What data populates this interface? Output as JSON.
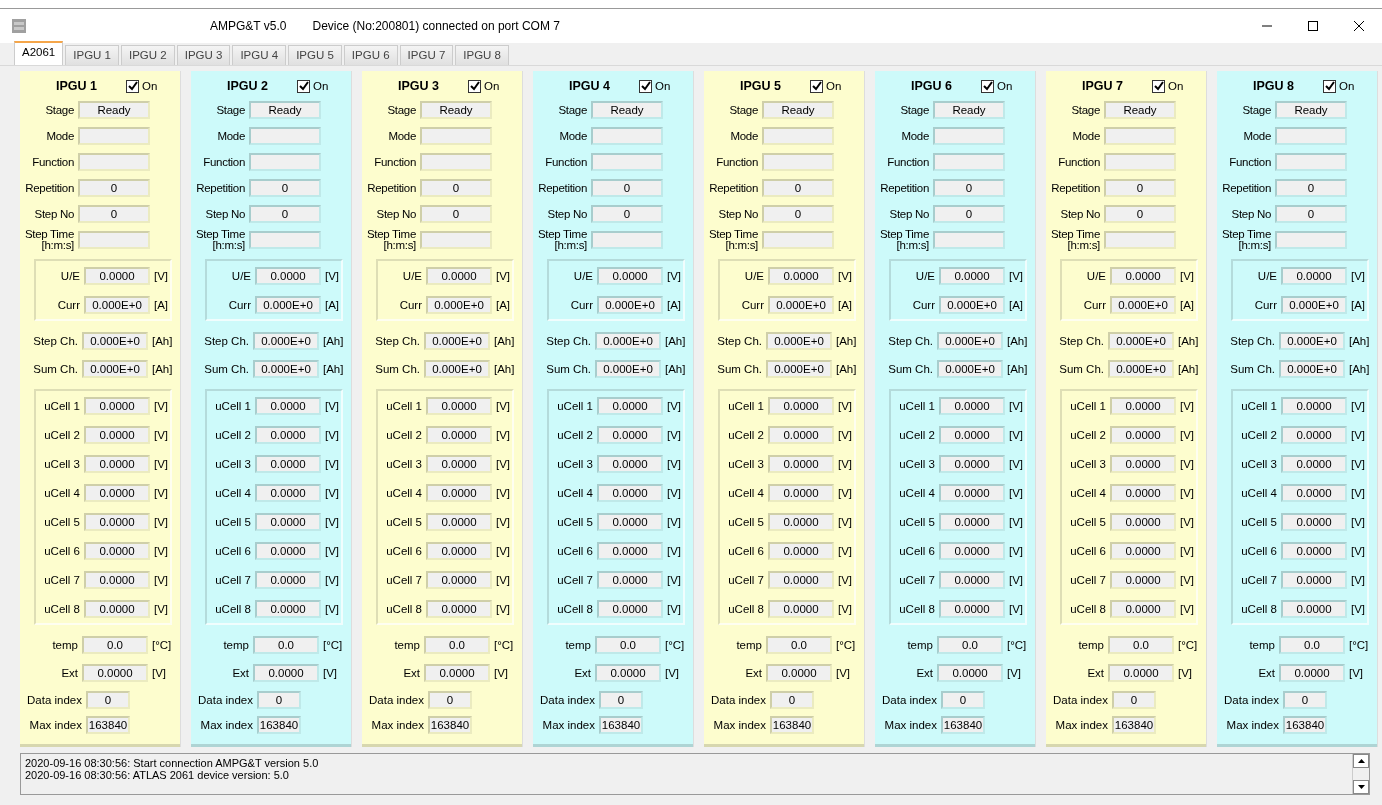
{
  "window": {
    "title": "AMPG&T v5.0",
    "status": "Device (No:200801) connected on port COM 7"
  },
  "tabs": [
    {
      "label": "A2061",
      "selected": true
    },
    {
      "label": "IPGU 1",
      "selected": false
    },
    {
      "label": "IPGU 2",
      "selected": false
    },
    {
      "label": "IPGU 3",
      "selected": false
    },
    {
      "label": "IPGU 4",
      "selected": false
    },
    {
      "label": "IPGU 5",
      "selected": false
    },
    {
      "label": "IPGU 6",
      "selected": false
    },
    {
      "label": "IPGU 7",
      "selected": false
    },
    {
      "label": "IPGU 8",
      "selected": false
    }
  ],
  "panels": [
    {
      "title": "IPGU 1",
      "on_label": "On",
      "on": true,
      "color": "#fdfdce",
      "sections": [
        {
          "kind": "info",
          "rows": [
            {
              "label": "Stage",
              "value": "Ready"
            },
            {
              "label": "Mode"
            },
            {
              "label": "Function"
            },
            {
              "label": "Repetition",
              "value": "0"
            },
            {
              "label": "Step No",
              "value": "0"
            },
            {
              "label": "Step Time [h:m:s]"
            }
          ]
        },
        {
          "kind": "group",
          "rows": [
            {
              "label": "U/E",
              "value": "0.0000",
              "unit": "[V]"
            },
            {
              "label": "Curr",
              "value": "0.000E+0",
              "unit": "[A]"
            }
          ]
        },
        {
          "kind": "plain",
          "rows": [
            {
              "label": "Step Ch.",
              "value": "0.000E+0",
              "unit": "[Ah]"
            },
            {
              "label": "Sum Ch.",
              "value": "0.000E+0",
              "unit": "[Ah]"
            }
          ]
        },
        {
          "kind": "group",
          "rows": [
            {
              "label": "uCell 1",
              "value": "0.0000",
              "unit": "[V]"
            },
            {
              "label": "uCell 2",
              "value": "0.0000",
              "unit": "[V]"
            },
            {
              "label": "uCell 3",
              "value": "0.0000",
              "unit": "[V]"
            },
            {
              "label": "uCell 4",
              "value": "0.0000",
              "unit": "[V]"
            },
            {
              "label": "uCell 5",
              "value": "0.0000",
              "unit": "[V]"
            },
            {
              "label": "uCell 6",
              "value": "0.0000",
              "unit": "[V]"
            },
            {
              "label": "uCell 7",
              "value": "0.0000",
              "unit": "[V]"
            },
            {
              "label": "uCell 8",
              "value": "0.0000",
              "unit": "[V]"
            }
          ]
        },
        {
          "kind": "plain",
          "rows": [
            {
              "label": "temp",
              "value": "0.0",
              "unit": "[°C]"
            },
            {
              "label": "Ext",
              "value": "0.0000",
              "unit": "[V]"
            }
          ]
        },
        {
          "kind": "index",
          "rows": [
            {
              "label": "Data index",
              "value": "0"
            },
            {
              "label": "Max index",
              "value": "163840"
            }
          ]
        }
      ]
    },
    {
      "title": "IPGU 2",
      "on_label": "On",
      "on": true,
      "color": "#cdfafa",
      "sections": [
        {
          "kind": "info",
          "rows": [
            {
              "label": "Stage",
              "value": "Ready"
            },
            {
              "label": "Mode"
            },
            {
              "label": "Function"
            },
            {
              "label": "Repetition",
              "value": "0"
            },
            {
              "label": "Step No",
              "value": "0"
            },
            {
              "label": "Step Time [h:m:s]"
            }
          ]
        },
        {
          "kind": "group",
          "rows": [
            {
              "label": "U/E",
              "value": "0.0000",
              "unit": "[V]"
            },
            {
              "label": "Curr",
              "value": "0.000E+0",
              "unit": "[A]"
            }
          ]
        },
        {
          "kind": "plain",
          "rows": [
            {
              "label": "Step Ch.",
              "value": "0.000E+0",
              "unit": "[Ah]"
            },
            {
              "label": "Sum Ch.",
              "value": "0.000E+0",
              "unit": "[Ah]"
            }
          ]
        },
        {
          "kind": "group",
          "rows": [
            {
              "label": "uCell 1",
              "value": "0.0000",
              "unit": "[V]"
            },
            {
              "label": "uCell 2",
              "value": "0.0000",
              "unit": "[V]"
            },
            {
              "label": "uCell 3",
              "value": "0.0000",
              "unit": "[V]"
            },
            {
              "label": "uCell 4",
              "value": "0.0000",
              "unit": "[V]"
            },
            {
              "label": "uCell 5",
              "value": "0.0000",
              "unit": "[V]"
            },
            {
              "label": "uCell 6",
              "value": "0.0000",
              "unit": "[V]"
            },
            {
              "label": "uCell 7",
              "value": "0.0000",
              "unit": "[V]"
            },
            {
              "label": "uCell 8",
              "value": "0.0000",
              "unit": "[V]"
            }
          ]
        },
        {
          "kind": "plain",
          "rows": [
            {
              "label": "temp",
              "value": "0.0",
              "unit": "[°C]"
            },
            {
              "label": "Ext",
              "value": "0.0000",
              "unit": "[V]"
            }
          ]
        },
        {
          "kind": "index",
          "rows": [
            {
              "label": "Data index",
              "value": "0"
            },
            {
              "label": "Max index",
              "value": "163840"
            }
          ]
        }
      ]
    },
    {
      "title": "IPGU 3",
      "on_label": "On",
      "on": true,
      "color": "#fdfdce",
      "sections": [
        {
          "kind": "info",
          "rows": [
            {
              "label": "Stage",
              "value": "Ready"
            },
            {
              "label": "Mode"
            },
            {
              "label": "Function"
            },
            {
              "label": "Repetition",
              "value": "0"
            },
            {
              "label": "Step No",
              "value": "0"
            },
            {
              "label": "Step Time [h:m:s]"
            }
          ]
        },
        {
          "kind": "group",
          "rows": [
            {
              "label": "U/E",
              "value": "0.0000",
              "unit": "[V]"
            },
            {
              "label": "Curr",
              "value": "0.000E+0",
              "unit": "[A]"
            }
          ]
        },
        {
          "kind": "plain",
          "rows": [
            {
              "label": "Step Ch.",
              "value": "0.000E+0",
              "unit": "[Ah]"
            },
            {
              "label": "Sum Ch.",
              "value": "0.000E+0",
              "unit": "[Ah]"
            }
          ]
        },
        {
          "kind": "group",
          "rows": [
            {
              "label": "uCell 1",
              "value": "0.0000",
              "unit": "[V]"
            },
            {
              "label": "uCell 2",
              "value": "0.0000",
              "unit": "[V]"
            },
            {
              "label": "uCell 3",
              "value": "0.0000",
              "unit": "[V]"
            },
            {
              "label": "uCell 4",
              "value": "0.0000",
              "unit": "[V]"
            },
            {
              "label": "uCell 5",
              "value": "0.0000",
              "unit": "[V]"
            },
            {
              "label": "uCell 6",
              "value": "0.0000",
              "unit": "[V]"
            },
            {
              "label": "uCell 7",
              "value": "0.0000",
              "unit": "[V]"
            },
            {
              "label": "uCell 8",
              "value": "0.0000",
              "unit": "[V]"
            }
          ]
        },
        {
          "kind": "plain",
          "rows": [
            {
              "label": "temp",
              "value": "0.0",
              "unit": "[°C]"
            },
            {
              "label": "Ext",
              "value": "0.0000",
              "unit": "[V]"
            }
          ]
        },
        {
          "kind": "index",
          "rows": [
            {
              "label": "Data index",
              "value": "0"
            },
            {
              "label": "Max index",
              "value": "163840"
            }
          ]
        }
      ]
    },
    {
      "title": "IPGU 4",
      "on_label": "On",
      "on": true,
      "color": "#cdfafa",
      "sections": [
        {
          "kind": "info",
          "rows": [
            {
              "label": "Stage",
              "value": "Ready"
            },
            {
              "label": "Mode"
            },
            {
              "label": "Function"
            },
            {
              "label": "Repetition",
              "value": "0"
            },
            {
              "label": "Step No",
              "value": "0"
            },
            {
              "label": "Step Time [h:m:s]"
            }
          ]
        },
        {
          "kind": "group",
          "rows": [
            {
              "label": "U/E",
              "value": "0.0000",
              "unit": "[V]"
            },
            {
              "label": "Curr",
              "value": "0.000E+0",
              "unit": "[A]"
            }
          ]
        },
        {
          "kind": "plain",
          "rows": [
            {
              "label": "Step Ch.",
              "value": "0.000E+0",
              "unit": "[Ah]"
            },
            {
              "label": "Sum Ch.",
              "value": "0.000E+0",
              "unit": "[Ah]"
            }
          ]
        },
        {
          "kind": "group",
          "rows": [
            {
              "label": "uCell 1",
              "value": "0.0000",
              "unit": "[V]"
            },
            {
              "label": "uCell 2",
              "value": "0.0000",
              "unit": "[V]"
            },
            {
              "label": "uCell 3",
              "value": "0.0000",
              "unit": "[V]"
            },
            {
              "label": "uCell 4",
              "value": "0.0000",
              "unit": "[V]"
            },
            {
              "label": "uCell 5",
              "value": "0.0000",
              "unit": "[V]"
            },
            {
              "label": "uCell 6",
              "value": "0.0000",
              "unit": "[V]"
            },
            {
              "label": "uCell 7",
              "value": "0.0000",
              "unit": "[V]"
            },
            {
              "label": "uCell 8",
              "value": "0.0000",
              "unit": "[V]"
            }
          ]
        },
        {
          "kind": "plain",
          "rows": [
            {
              "label": "temp",
              "value": "0.0",
              "unit": "[°C]"
            },
            {
              "label": "Ext",
              "value": "0.0000",
              "unit": "[V]"
            }
          ]
        },
        {
          "kind": "index",
          "rows": [
            {
              "label": "Data index",
              "value": "0"
            },
            {
              "label": "Max index",
              "value": "163840"
            }
          ]
        }
      ]
    },
    {
      "title": "IPGU 5",
      "on_label": "On",
      "on": true,
      "color": "#fdfdce",
      "sections": [
        {
          "kind": "info",
          "rows": [
            {
              "label": "Stage",
              "value": "Ready"
            },
            {
              "label": "Mode"
            },
            {
              "label": "Function"
            },
            {
              "label": "Repetition",
              "value": "0"
            },
            {
              "label": "Step No",
              "value": "0"
            },
            {
              "label": "Step Time [h:m:s]"
            }
          ]
        },
        {
          "kind": "group",
          "rows": [
            {
              "label": "U/E",
              "value": "0.0000",
              "unit": "[V]"
            },
            {
              "label": "Curr",
              "value": "0.000E+0",
              "unit": "[A]"
            }
          ]
        },
        {
          "kind": "plain",
          "rows": [
            {
              "label": "Step Ch.",
              "value": "0.000E+0",
              "unit": "[Ah]"
            },
            {
              "label": "Sum Ch.",
              "value": "0.000E+0",
              "unit": "[Ah]"
            }
          ]
        },
        {
          "kind": "group",
          "rows": [
            {
              "label": "uCell 1",
              "value": "0.0000",
              "unit": "[V]"
            },
            {
              "label": "uCell 2",
              "value": "0.0000",
              "unit": "[V]"
            },
            {
              "label": "uCell 3",
              "value": "0.0000",
              "unit": "[V]"
            },
            {
              "label": "uCell 4",
              "value": "0.0000",
              "unit": "[V]"
            },
            {
              "label": "uCell 5",
              "value": "0.0000",
              "unit": "[V]"
            },
            {
              "label": "uCell 6",
              "value": "0.0000",
              "unit": "[V]"
            },
            {
              "label": "uCell 7",
              "value": "0.0000",
              "unit": "[V]"
            },
            {
              "label": "uCell 8",
              "value": "0.0000",
              "unit": "[V]"
            }
          ]
        },
        {
          "kind": "plain",
          "rows": [
            {
              "label": "temp",
              "value": "0.0",
              "unit": "[°C]"
            },
            {
              "label": "Ext",
              "value": "0.0000",
              "unit": "[V]"
            }
          ]
        },
        {
          "kind": "index",
          "rows": [
            {
              "label": "Data index",
              "value": "0"
            },
            {
              "label": "Max index",
              "value": "163840"
            }
          ]
        }
      ]
    },
    {
      "title": "IPGU 6",
      "on_label": "On",
      "on": true,
      "color": "#cdfafa",
      "sections": [
        {
          "kind": "info",
          "rows": [
            {
              "label": "Stage",
              "value": "Ready"
            },
            {
              "label": "Mode"
            },
            {
              "label": "Function"
            },
            {
              "label": "Repetition",
              "value": "0"
            },
            {
              "label": "Step No",
              "value": "0"
            },
            {
              "label": "Step Time [h:m:s]"
            }
          ]
        },
        {
          "kind": "group",
          "rows": [
            {
              "label": "U/E",
              "value": "0.0000",
              "unit": "[V]"
            },
            {
              "label": "Curr",
              "value": "0.000E+0",
              "unit": "[A]"
            }
          ]
        },
        {
          "kind": "plain",
          "rows": [
            {
              "label": "Step Ch.",
              "value": "0.000E+0",
              "unit": "[Ah]"
            },
            {
              "label": "Sum Ch.",
              "value": "0.000E+0",
              "unit": "[Ah]"
            }
          ]
        },
        {
          "kind": "group",
          "rows": [
            {
              "label": "uCell 1",
              "value": "0.0000",
              "unit": "[V]"
            },
            {
              "label": "uCell 2",
              "value": "0.0000",
              "unit": "[V]"
            },
            {
              "label": "uCell 3",
              "value": "0.0000",
              "unit": "[V]"
            },
            {
              "label": "uCell 4",
              "value": "0.0000",
              "unit": "[V]"
            },
            {
              "label": "uCell 5",
              "value": "0.0000",
              "unit": "[V]"
            },
            {
              "label": "uCell 6",
              "value": "0.0000",
              "unit": "[V]"
            },
            {
              "label": "uCell 7",
              "value": "0.0000",
              "unit": "[V]"
            },
            {
              "label": "uCell 8",
              "value": "0.0000",
              "unit": "[V]"
            }
          ]
        },
        {
          "kind": "plain",
          "rows": [
            {
              "label": "temp",
              "value": "0.0",
              "unit": "[°C]"
            },
            {
              "label": "Ext",
              "value": "0.0000",
              "unit": "[V]"
            }
          ]
        },
        {
          "kind": "index",
          "rows": [
            {
              "label": "Data index",
              "value": "0"
            },
            {
              "label": "Max index",
              "value": "163840"
            }
          ]
        }
      ]
    },
    {
      "title": "IPGU 7",
      "on_label": "On",
      "on": true,
      "color": "#fdfdce",
      "sections": [
        {
          "kind": "info",
          "rows": [
            {
              "label": "Stage",
              "value": "Ready"
            },
            {
              "label": "Mode"
            },
            {
              "label": "Function"
            },
            {
              "label": "Repetition",
              "value": "0"
            },
            {
              "label": "Step No",
              "value": "0"
            },
            {
              "label": "Step Time [h:m:s]"
            }
          ]
        },
        {
          "kind": "group",
          "rows": [
            {
              "label": "U/E",
              "value": "0.0000",
              "unit": "[V]"
            },
            {
              "label": "Curr",
              "value": "0.000E+0",
              "unit": "[A]"
            }
          ]
        },
        {
          "kind": "plain",
          "rows": [
            {
              "label": "Step Ch.",
              "value": "0.000E+0",
              "unit": "[Ah]"
            },
            {
              "label": "Sum Ch.",
              "value": "0.000E+0",
              "unit": "[Ah]"
            }
          ]
        },
        {
          "kind": "group",
          "rows": [
            {
              "label": "uCell 1",
              "value": "0.0000",
              "unit": "[V]"
            },
            {
              "label": "uCell 2",
              "value": "0.0000",
              "unit": "[V]"
            },
            {
              "label": "uCell 3",
              "value": "0.0000",
              "unit": "[V]"
            },
            {
              "label": "uCell 4",
              "value": "0.0000",
              "unit": "[V]"
            },
            {
              "label": "uCell 5",
              "value": "0.0000",
              "unit": "[V]"
            },
            {
              "label": "uCell 6",
              "value": "0.0000",
              "unit": "[V]"
            },
            {
              "label": "uCell 7",
              "value": "0.0000",
              "unit": "[V]"
            },
            {
              "label": "uCell 8",
              "value": "0.0000",
              "unit": "[V]"
            }
          ]
        },
        {
          "kind": "plain",
          "rows": [
            {
              "label": "temp",
              "value": "0.0",
              "unit": "[°C]"
            },
            {
              "label": "Ext",
              "value": "0.0000",
              "unit": "[V]"
            }
          ]
        },
        {
          "kind": "index",
          "rows": [
            {
              "label": "Data index",
              "value": "0"
            },
            {
              "label": "Max index",
              "value": "163840"
            }
          ]
        }
      ]
    },
    {
      "title": "IPGU 8",
      "on_label": "On",
      "on": true,
      "color": "#cdfafa",
      "sections": [
        {
          "kind": "info",
          "rows": [
            {
              "label": "Stage",
              "value": "Ready"
            },
            {
              "label": "Mode"
            },
            {
              "label": "Function"
            },
            {
              "label": "Repetition",
              "value": "0"
            },
            {
              "label": "Step No",
              "value": "0"
            },
            {
              "label": "Step Time [h:m:s]"
            }
          ]
        },
        {
          "kind": "group",
          "rows": [
            {
              "label": "U/E",
              "value": "0.0000",
              "unit": "[V]"
            },
            {
              "label": "Curr",
              "value": "0.000E+0",
              "unit": "[A]"
            }
          ]
        },
        {
          "kind": "plain",
          "rows": [
            {
              "label": "Step Ch.",
              "value": "0.000E+0",
              "unit": "[Ah]"
            },
            {
              "label": "Sum Ch.",
              "value": "0.000E+0",
              "unit": "[Ah]"
            }
          ]
        },
        {
          "kind": "group",
          "rows": [
            {
              "label": "uCell 1",
              "value": "0.0000",
              "unit": "[V]"
            },
            {
              "label": "uCell 2",
              "value": "0.0000",
              "unit": "[V]"
            },
            {
              "label": "uCell 3",
              "value": "0.0000",
              "unit": "[V]"
            },
            {
              "label": "uCell 4",
              "value": "0.0000",
              "unit": "[V]"
            },
            {
              "label": "uCell 5",
              "value": "0.0000",
              "unit": "[V]"
            },
            {
              "label": "uCell 6",
              "value": "0.0000",
              "unit": "[V]"
            },
            {
              "label": "uCell 7",
              "value": "0.0000",
              "unit": "[V]"
            },
            {
              "label": "uCell 8",
              "value": "0.0000",
              "unit": "[V]"
            }
          ]
        },
        {
          "kind": "plain",
          "rows": [
            {
              "label": "temp",
              "value": "0.0",
              "unit": "[°C]"
            },
            {
              "label": "Ext",
              "value": "0.0000",
              "unit": "[V]"
            }
          ]
        },
        {
          "kind": "index",
          "rows": [
            {
              "label": "Data index",
              "value": "0"
            },
            {
              "label": "Max index",
              "value": "163840"
            }
          ]
        }
      ]
    }
  ],
  "log": [
    "2020-09-16 08:30:56: Start connection AMPG&T version 5.0",
    "2020-09-16 08:30:56: ATLAS 2061 device version: 5.0"
  ]
}
